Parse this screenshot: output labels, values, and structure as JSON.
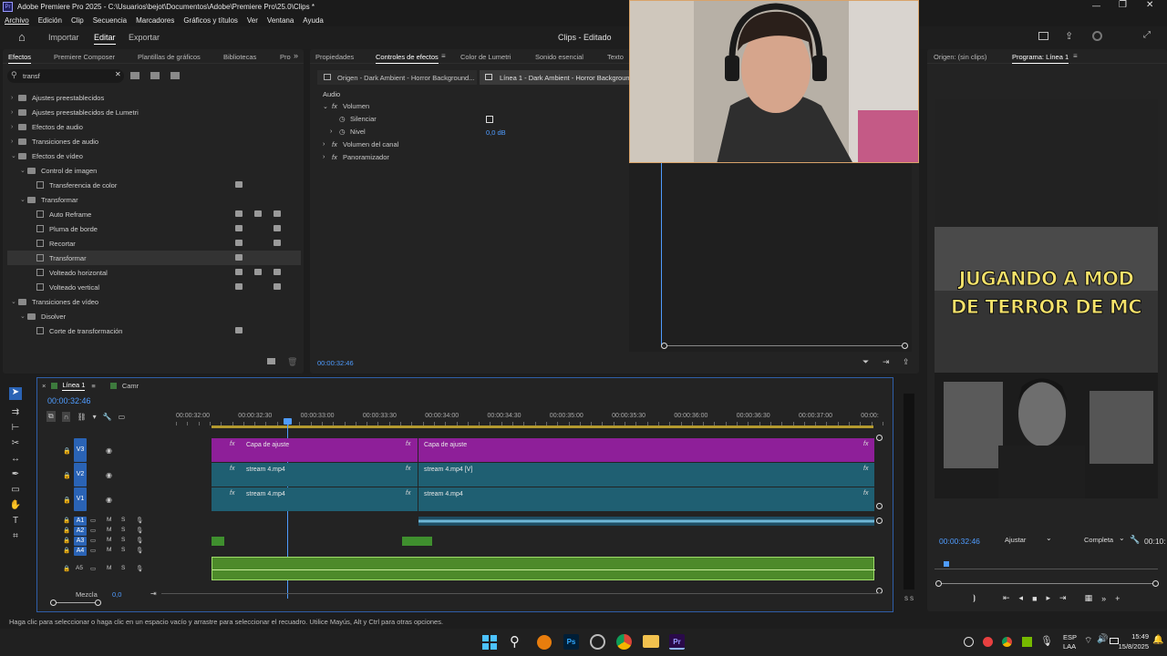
{
  "titlebar": {
    "app_icon": "Pr",
    "title": "Adobe Premiere Pro 2025 - C:\\Usuarios\\bejot\\Documentos\\Adobe\\Premiere Pro\\25.0\\Clips *"
  },
  "menu": [
    "Archivo",
    "Edición",
    "Clip",
    "Secuencia",
    "Marcadores",
    "Gráficos y títulos",
    "Ver",
    "Ventana",
    "Ayuda"
  ],
  "workspace": {
    "tabs": [
      "Importar",
      "Editar",
      "Exportar"
    ],
    "active_tab": "Editar",
    "project_title": "Clips - Editado"
  },
  "effects_panel": {
    "tabs": [
      "Efectos",
      "Premiere Composer",
      "Plantillas de gráficos",
      "Bibliotecas",
      "Pro"
    ],
    "search_value": "transf",
    "tree": [
      {
        "label": "Ajustes preestablecidos",
        "level": 0,
        "type": "folder",
        "expanded": false
      },
      {
        "label": "Ajustes preestablecidos de Lumetri",
        "level": 0,
        "type": "folder",
        "expanded": false
      },
      {
        "label": "Efectos de audio",
        "level": 0,
        "type": "folder",
        "expanded": false
      },
      {
        "label": "Transiciones de audio",
        "level": 0,
        "type": "folder",
        "expanded": false
      },
      {
        "label": "Efectos de vídeo",
        "level": 0,
        "type": "folder",
        "expanded": true
      },
      {
        "label": "Control de imagen",
        "level": 1,
        "type": "folder",
        "expanded": true
      },
      {
        "label": "Transferencia de color",
        "level": 2,
        "type": "effect",
        "badges": 1
      },
      {
        "label": "Transformar",
        "level": 1,
        "type": "folder",
        "expanded": true
      },
      {
        "label": "Auto Reframe",
        "level": 2,
        "type": "effect",
        "badges": 3
      },
      {
        "label": "Pluma de borde",
        "level": 2,
        "type": "effect",
        "badges": 2
      },
      {
        "label": "Recortar",
        "level": 2,
        "type": "effect",
        "badges": 2
      },
      {
        "label": "Transformar",
        "level": 2,
        "type": "effect",
        "badges": 1,
        "selected": true
      },
      {
        "label": "Volteado horizontal",
        "level": 2,
        "type": "effect",
        "badges": 3
      },
      {
        "label": "Volteado vertical",
        "level": 2,
        "type": "effect",
        "badges": 2
      },
      {
        "label": "Transiciones de vídeo",
        "level": 0,
        "type": "folder",
        "expanded": true
      },
      {
        "label": "Disolver",
        "level": 1,
        "type": "folder",
        "expanded": true
      },
      {
        "label": "Corte de transformación",
        "level": 2,
        "type": "effect",
        "badges": 1
      }
    ]
  },
  "effect_controls": {
    "tabs": [
      "Propiedades",
      "Controles de efectos",
      "Color de Lumetri",
      "Sonido esencial",
      "Texto"
    ],
    "source_clip": "Origen - Dark Ambient - Horror Background...",
    "target_clip": "Línea 1 - Dark Ambient - Horror Backgroun",
    "section": "Audio",
    "volume_label": "Volumen",
    "mute_label": "Silenciar",
    "level_label": "Nivel",
    "level_value": "0,0 dB",
    "channel_volume_label": "Volumen del canal",
    "panner_label": "Panoramizador",
    "timecode": "00:00:32:46"
  },
  "program_monitor": {
    "tabs": [
      "Origen: (sin clips)",
      "Programa: Línea 1"
    ],
    "overlay_line1": "JUGANDO A MOD",
    "overlay_line2": "DE TERROR DE MC",
    "timecode": "00:00:32:46",
    "fit_label": "Ajustar",
    "quality_label": "Completa",
    "duration": "00:10:"
  },
  "timeline": {
    "tabs": [
      "Línea 1",
      "Camr"
    ],
    "timecode": "00:00:32:46",
    "ruler": [
      "00:00:32:00",
      "00:00:32:30",
      "00:00:33:00",
      "00:00:33:30",
      "00:00:34:00",
      "00:00:34:30",
      "00:00:35:00",
      "00:00:35:30",
      "00:00:36:00",
      "00:00:36:30",
      "00:00:37:00",
      "00:00:"
    ],
    "video_tracks": [
      "V3",
      "V2",
      "V1"
    ],
    "audio_tracks": [
      "A1",
      "A2",
      "A3",
      "A4",
      "A5"
    ],
    "clips": {
      "v3_a": "Capa de ajuste",
      "v3_b": "Capa de ajuste",
      "v2_a": "stream 4.mp4",
      "v2_b": "stream 4.mp4 [V]",
      "v1_a": "stream 4.mp4",
      "v1_b": "stream 4.mp4"
    },
    "mix_label": "Mezcla",
    "mix_value": "0,0",
    "track_letters": {
      "m": "M",
      "s": "S"
    }
  },
  "status_text": "Haga clic para seleccionar o haga clic en un espacio vacío y arrastre para seleccionar el recuadro. Utilice Mayús, Alt y Ctrl para otras opciones.",
  "taskbar": {
    "lang_top": "ESP",
    "lang_bottom": "LAA",
    "time": "15:49",
    "date": "15/8/2025",
    "photoshop_label": "Ps",
    "premiere_label": "Pr"
  }
}
